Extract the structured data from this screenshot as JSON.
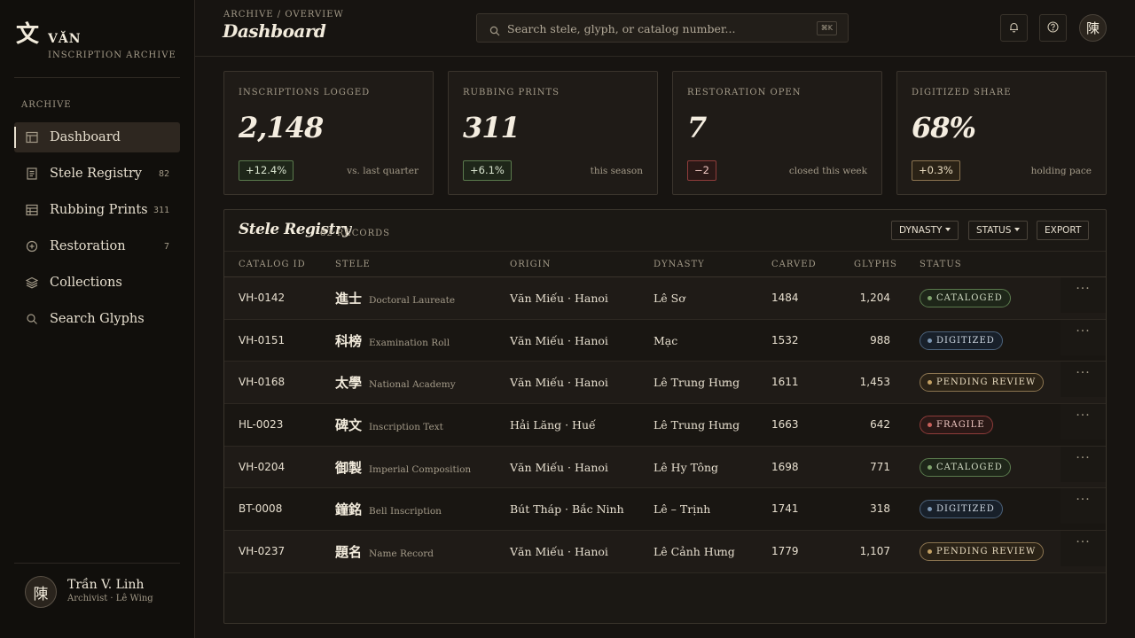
{
  "brand": {
    "glyph": "文",
    "name": "VĂN",
    "subtitle": "INSCRIPTION ARCHIVE"
  },
  "sidebar": {
    "section": "ARCHIVE",
    "items": [
      {
        "label": "Dashboard",
        "count": "",
        "icon": "table-icon",
        "active": true
      },
      {
        "label": "Stele Registry",
        "count": "82",
        "icon": "document-icon"
      },
      {
        "label": "Rubbing Prints",
        "count": "311",
        "icon": "grid-icon"
      },
      {
        "label": "Restoration",
        "count": "7",
        "icon": "plus-circle-icon"
      },
      {
        "label": "Collections",
        "count": "",
        "icon": "layers-icon"
      },
      {
        "label": "Search Glyphs",
        "count": "",
        "icon": "search-icon"
      }
    ]
  },
  "user": {
    "avatar": "陳",
    "name": "Trần V. Linh",
    "role": "Archivist · Lê Wing"
  },
  "header": {
    "breadcrumb": "ARCHIVE / OVERVIEW",
    "title": "Dashboard",
    "search_placeholder": "Search stele, glyph, or catalog number...",
    "shortcut": "⌘K",
    "avatar": "陳"
  },
  "stats": [
    {
      "label": "INSCRIPTIONS LOGGED",
      "value": "2,148",
      "delta": "+12.4%",
      "trend": "up",
      "note": "vs. last quarter"
    },
    {
      "label": "RUBBING PRINTS",
      "value": "311",
      "delta": "+6.1%",
      "trend": "up",
      "note": "this season"
    },
    {
      "label": "RESTORATION OPEN",
      "value": "7",
      "delta": "−2",
      "trend": "down",
      "note": "closed this week"
    },
    {
      "label": "DIGITIZED SHARE",
      "value": "68%",
      "delta": "+0.3%",
      "trend": "flat",
      "note": "holding pace"
    }
  ],
  "registry": {
    "title": "Stele Registry",
    "count": "82 RECORDS",
    "buttons": {
      "dynasty": "DYNASTY",
      "status": "STATUS",
      "export": "EXPORT"
    },
    "columns": [
      "CATALOG ID",
      "STELE",
      "ORIGIN",
      "DYNASTY",
      "CARVED",
      "GLYPHS",
      "STATUS"
    ],
    "rows": [
      {
        "id": "VH-0142",
        "han": "進士",
        "en": "Doctoral Laureate",
        "origin": "Văn Miếu · Hanoi",
        "dynasty": "Lê Sơ",
        "carved": "1484",
        "glyphs": "1,204",
        "status": "CATALOGED",
        "status_kind": "cataloged"
      },
      {
        "id": "VH-0151",
        "han": "科榜",
        "en": "Examination Roll",
        "origin": "Văn Miếu · Hanoi",
        "dynasty": "Mạc",
        "carved": "1532",
        "glyphs": "988",
        "status": "DIGITIZED",
        "status_kind": "digitized"
      },
      {
        "id": "VH-0168",
        "han": "太學",
        "en": "National Academy",
        "origin": "Văn Miếu · Hanoi",
        "dynasty": "Lê Trung Hưng",
        "carved": "1611",
        "glyphs": "1,453",
        "status": "PENDING REVIEW",
        "status_kind": "pending"
      },
      {
        "id": "HL-0023",
        "han": "碑文",
        "en": "Inscription Text",
        "origin": "Hải Lăng · Huế",
        "dynasty": "Lê Trung Hưng",
        "carved": "1663",
        "glyphs": "642",
        "status": "FRAGILE",
        "status_kind": "fragile"
      },
      {
        "id": "VH-0204",
        "han": "御製",
        "en": "Imperial Composition",
        "origin": "Văn Miếu · Hanoi",
        "dynasty": "Lê Hy Tông",
        "carved": "1698",
        "glyphs": "771",
        "status": "CATALOGED",
        "status_kind": "cataloged"
      },
      {
        "id": "BT-0008",
        "han": "鐘銘",
        "en": "Bell Inscription",
        "origin": "Bút Tháp · Bắc Ninh",
        "dynasty": "Lê – Trịnh",
        "carved": "1741",
        "glyphs": "318",
        "status": "DIGITIZED",
        "status_kind": "digitized"
      },
      {
        "id": "VH-0237",
        "han": "題名",
        "en": "Name Record",
        "origin": "Văn Miếu · Hanoi",
        "dynasty": "Lê Cảnh Hưng",
        "carved": "1779",
        "glyphs": "1,107",
        "status": "PENDING REVIEW",
        "status_kind": "pending"
      }
    ],
    "row_menu": "···"
  }
}
